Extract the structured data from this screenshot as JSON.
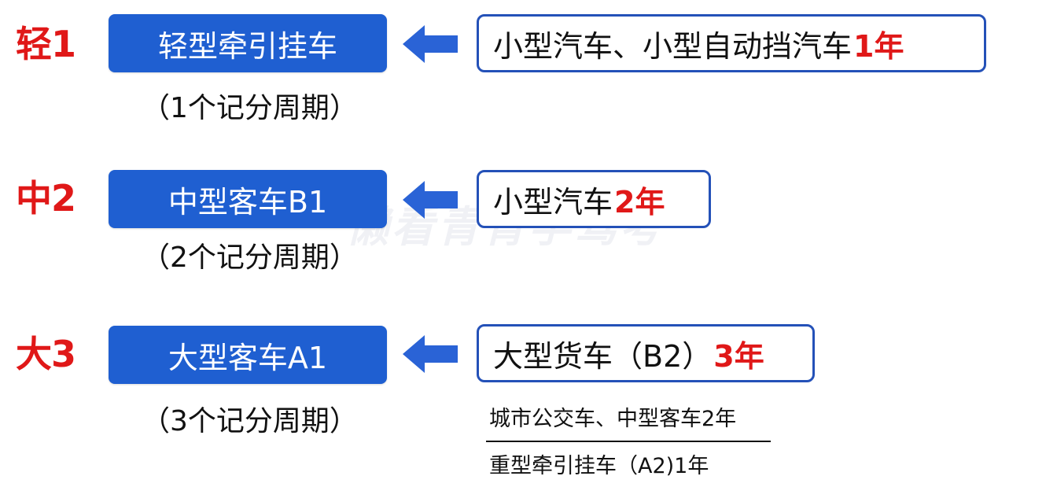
{
  "rows": [
    {
      "level": "轻1",
      "type": "轻型牵引挂车",
      "period": "（1个记分周期）",
      "source": "小型汽车、小型自动挡汽车",
      "years": "1年"
    },
    {
      "level": "中2",
      "type": "中型客车B1",
      "period": "（2个记分周期）",
      "source": "小型汽车",
      "years": "2年"
    },
    {
      "level": "大3",
      "type": "大型客车A1",
      "period": "（3个记分周期）",
      "source": "大型货车（B2）",
      "years": "3年",
      "notes": [
        "城市公交车、中型客车2年",
        "重型牵引挂车（A2)1年"
      ]
    }
  ],
  "watermark": "懒看青青学驾考",
  "colors": {
    "level_red": "#e01818",
    "button_blue": "#1f5fd1",
    "border_blue": "#2451b8",
    "arrow_blue": "#2a63d6"
  }
}
